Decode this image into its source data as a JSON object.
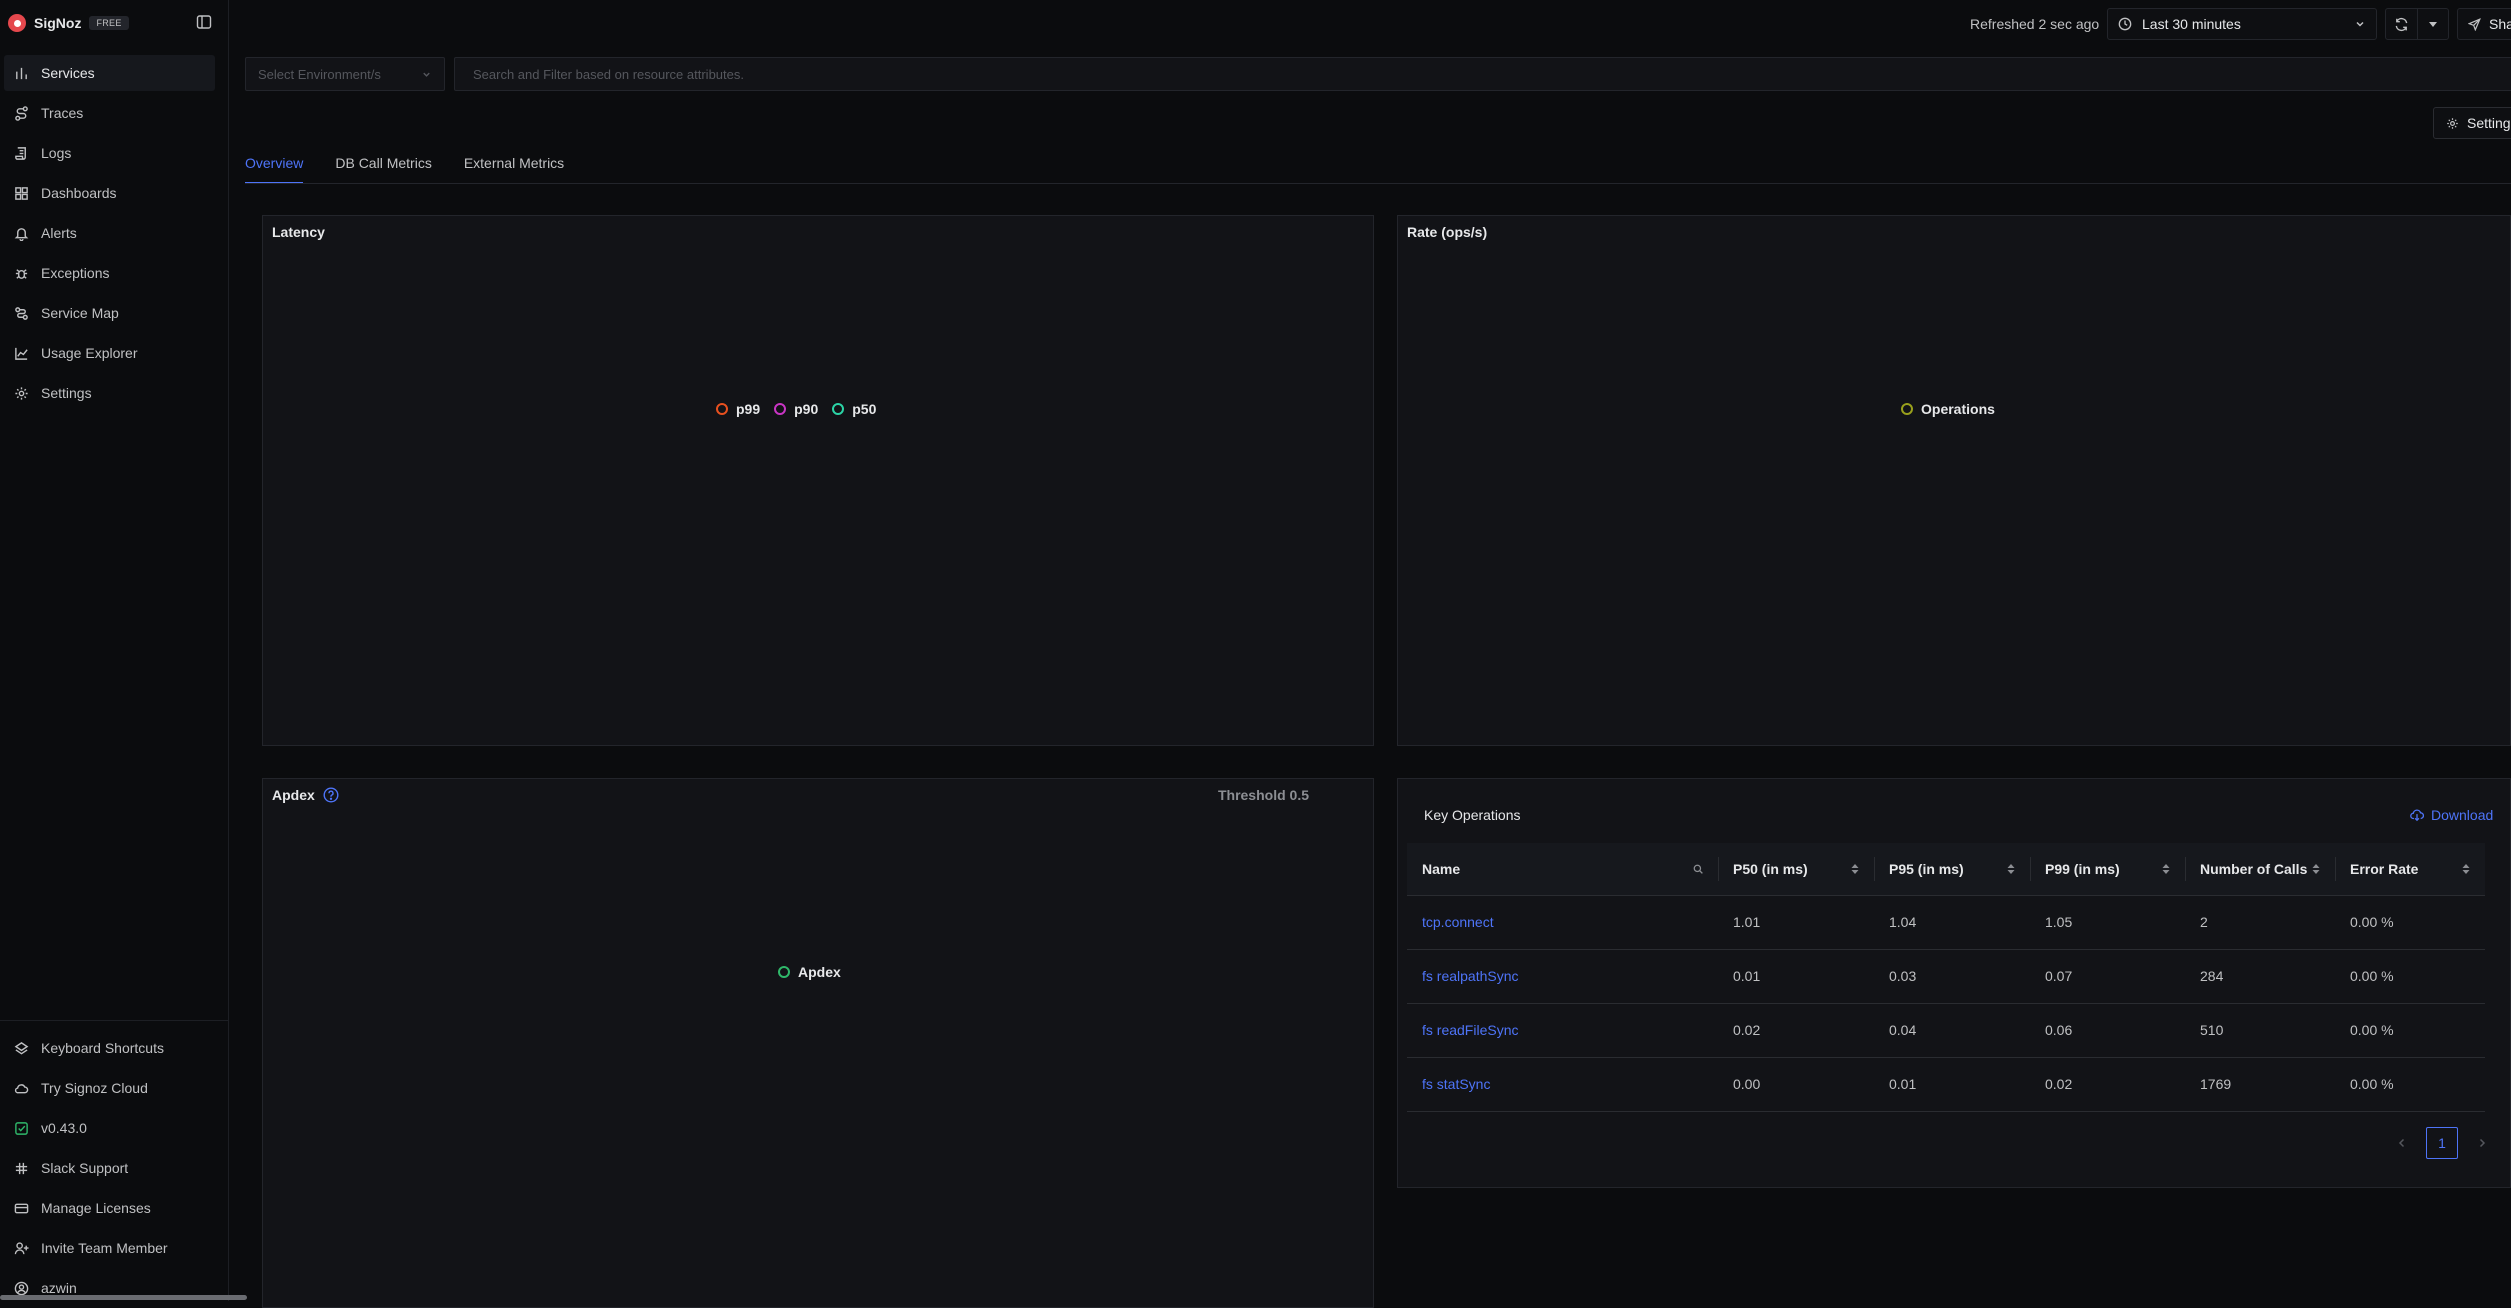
{
  "app": {
    "name": "SigNoz",
    "plan_badge": "FREE"
  },
  "sidebar": {
    "items": [
      {
        "label": "Services",
        "icon": "bar-chart-icon",
        "active": true
      },
      {
        "label": "Traces",
        "icon": "route-icon"
      },
      {
        "label": "Logs",
        "icon": "scroll-icon"
      },
      {
        "label": "Dashboards",
        "icon": "layout-grid-icon"
      },
      {
        "label": "Alerts",
        "icon": "bell-icon"
      },
      {
        "label": "Exceptions",
        "icon": "bug-icon"
      },
      {
        "label": "Service Map",
        "icon": "map-icon"
      },
      {
        "label": "Usage Explorer",
        "icon": "line-chart-icon"
      },
      {
        "label": "Settings",
        "icon": "gear-icon"
      }
    ],
    "bottom_items": [
      {
        "label": "Keyboard Shortcuts",
        "icon": "layers-icon"
      },
      {
        "label": "Try Signoz Cloud",
        "icon": "cloud-icon"
      },
      {
        "label": "v0.43.0",
        "icon": "check-square-icon"
      },
      {
        "label": "Slack Support",
        "icon": "slack-icon"
      },
      {
        "label": "Manage Licenses",
        "icon": "credit-card-icon"
      },
      {
        "label": "Invite Team Member",
        "icon": "user-plus-icon"
      },
      {
        "label": "azwin",
        "icon": "user-circle-icon"
      }
    ]
  },
  "topbar": {
    "refreshed_text": "Refreshed 2 sec ago",
    "time_range": "Last 30 minutes",
    "share_label": "Share"
  },
  "filters": {
    "environment_placeholder": "Select Environment/s",
    "search_placeholder": "Search and Filter based on resource attributes."
  },
  "settings_button": "Settings",
  "tabs": [
    {
      "label": "Overview",
      "active": true
    },
    {
      "label": "DB Call Metrics"
    },
    {
      "label": "External Metrics"
    }
  ],
  "panels": {
    "latency": {
      "title": "Latency",
      "legend": [
        {
          "name": "p99",
          "color": "#e8501f"
        },
        {
          "name": "p90",
          "color": "#c935c5"
        },
        {
          "name": "p50",
          "color": "#2bd3a6"
        }
      ]
    },
    "rate": {
      "title": "Rate (ops/s)",
      "legend": [
        {
          "name": "Operations",
          "color": "#99a01c"
        }
      ]
    },
    "apdex": {
      "title": "Apdex",
      "threshold": "Threshold 0.5",
      "legend": [
        {
          "name": "Apdex",
          "color": "#2fb86a"
        }
      ]
    }
  },
  "key_operations": {
    "title": "Key Operations",
    "download_label": "Download",
    "columns": [
      "Name",
      "P50 (in ms)",
      "P95 (in ms)",
      "P99 (in ms)",
      "Number of Calls",
      "Error Rate"
    ],
    "rows": [
      [
        "tcp.connect",
        "1.01",
        "1.04",
        "1.05",
        "2",
        "0.00 %"
      ],
      [
        "fs realpathSync",
        "0.01",
        "0.03",
        "0.07",
        "284",
        "0.00 %"
      ],
      [
        "fs readFileSync",
        "0.02",
        "0.04",
        "0.06",
        "510",
        "0.00 %"
      ],
      [
        "fs statSync",
        "0.00",
        "0.01",
        "0.02",
        "1769",
        "0.00 %"
      ]
    ],
    "current_page": "1"
  },
  "colors": {
    "accent": "#4e74f8",
    "background": "#0b0c0e",
    "panel": "#121317",
    "border": "#23252b"
  }
}
